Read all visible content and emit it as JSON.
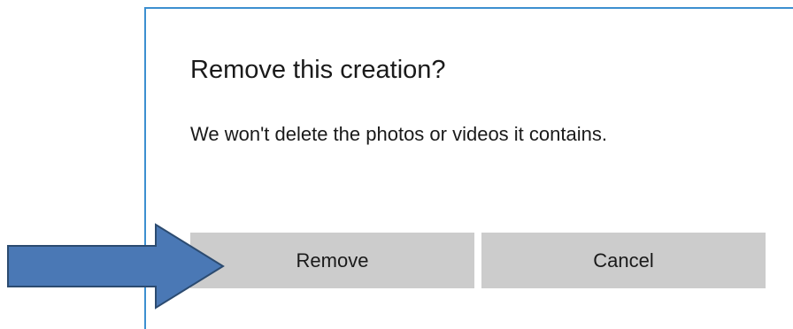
{
  "dialog": {
    "title": "Remove this creation?",
    "message": "We won't delete the photos or videos it contains.",
    "buttons": {
      "remove_label": "Remove",
      "cancel_label": "Cancel"
    }
  },
  "colors": {
    "dialog_border": "#3c8fd0",
    "button_background": "#cccccc",
    "text": "#1a1a1a",
    "arrow_fill": "#4a78b5",
    "arrow_stroke": "#2c4b70"
  },
  "icons": {
    "annotation": "right-arrow-icon"
  }
}
